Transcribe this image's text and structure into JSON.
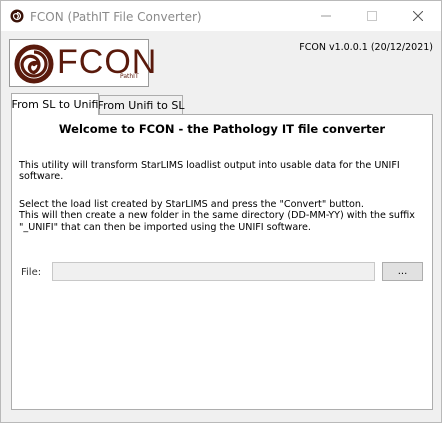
{
  "window": {
    "title": "FCON (PathIT File Converter)",
    "app_icon": "fcon-spiral-icon",
    "controls": [
      "minimize-icon",
      "maximize-icon",
      "close-icon"
    ]
  },
  "logo": {
    "text": "FCON",
    "sub": "PathIT",
    "color": "#5a1a0c"
  },
  "version": "FCON v1.0.0.1 (20/12/2021)",
  "tabs": [
    {
      "label": "From SL to Unifi",
      "active": true
    },
    {
      "label": "From Unifi to SL",
      "active": false
    }
  ],
  "main": {
    "welcome": "Welcome to FCON - the Pathology IT file converter",
    "paragraph1": "This utility will transform StarLIMS loadlist output into usable data for the UNIFI software.",
    "paragraph2_lines": [
      "Select the load list created by StarLIMS and press the \"Convert\" button.",
      "This will then create a new folder in the same directory (DD-MM-YY) with the suffix",
      "\"_UNIFI\" that can then be imported using the UNIFI software."
    ],
    "file_label": "File:",
    "file_value": "",
    "browse_label": "..."
  }
}
